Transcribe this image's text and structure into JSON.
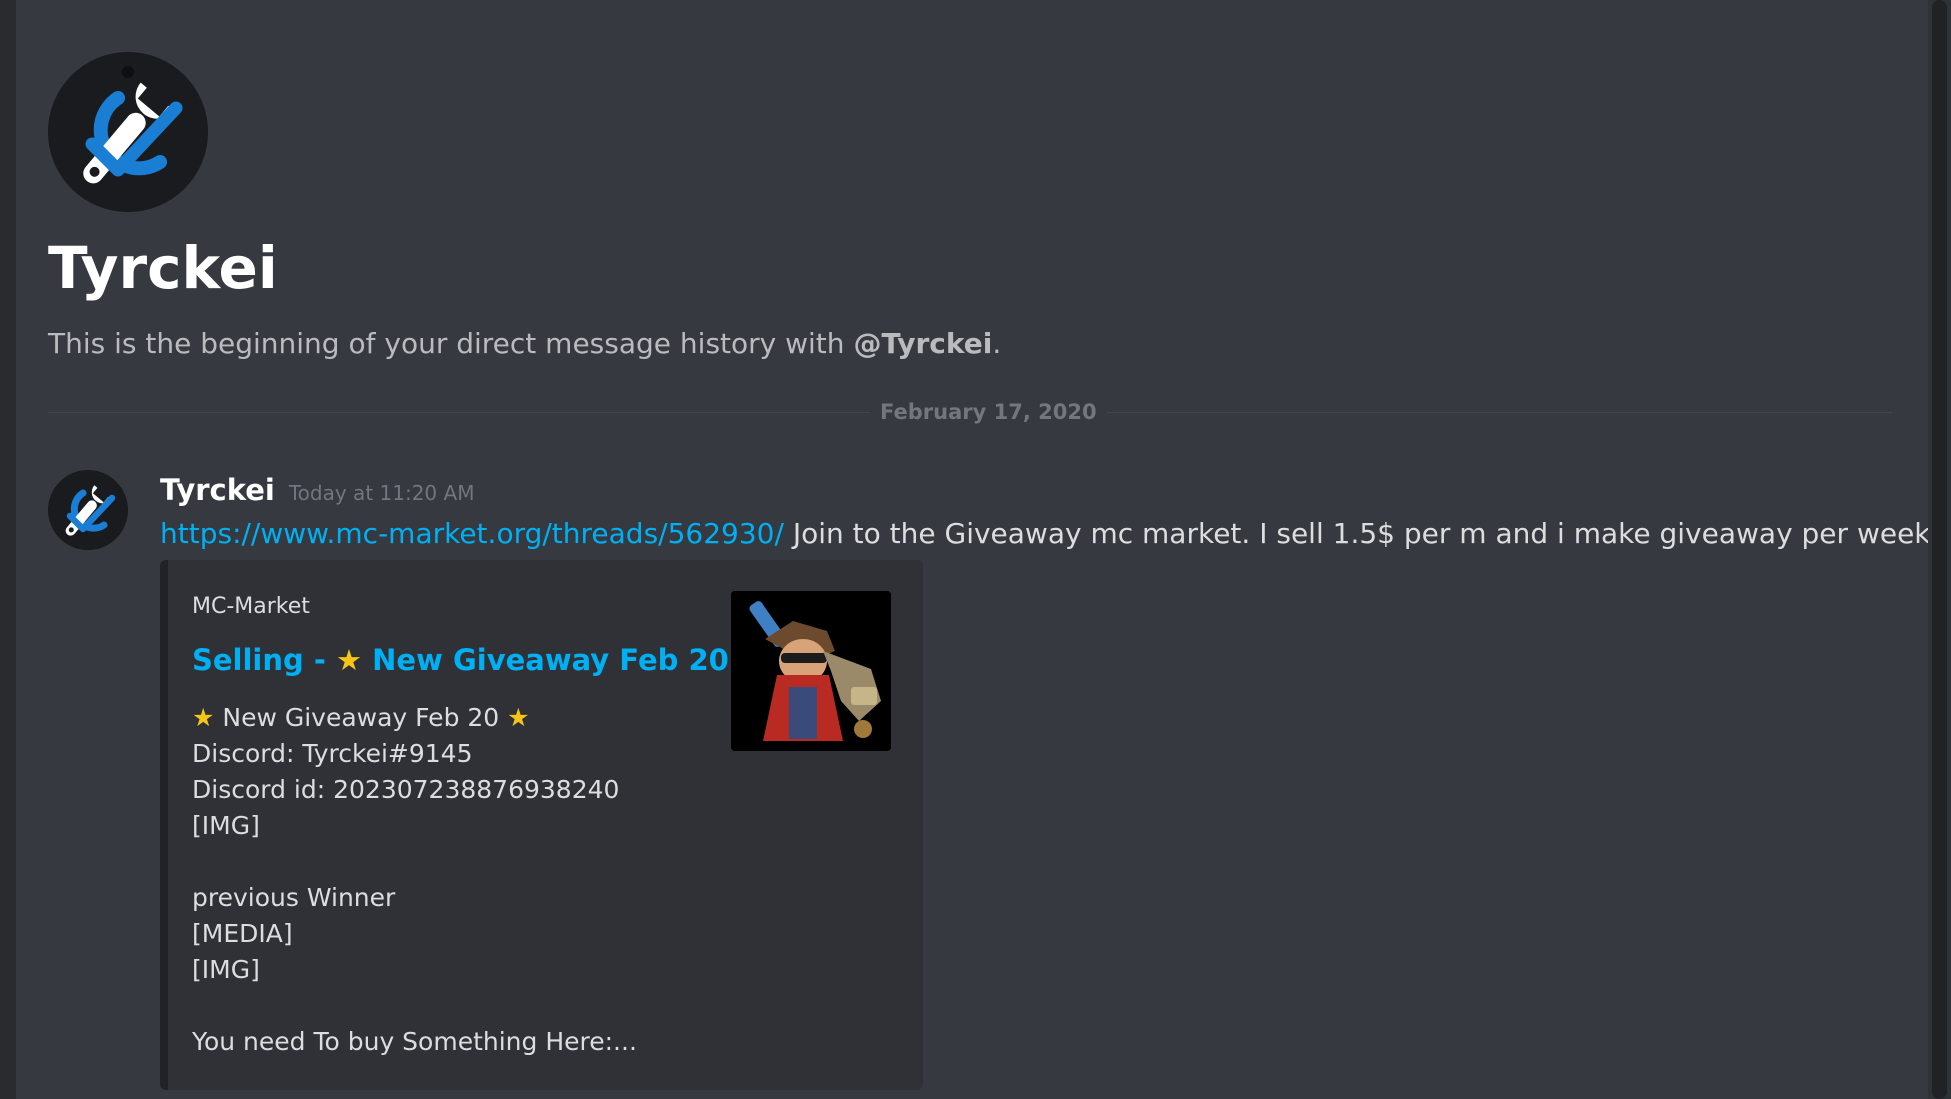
{
  "channel": {
    "title": "Tyrckei",
    "intro_prefix": "This is the beginning of your direct message history with ",
    "intro_mention": "@Tyrckei",
    "intro_suffix": "."
  },
  "divider": {
    "date": "February 17, 2020"
  },
  "message": {
    "author": "Tyrckei",
    "timestamp": "Today at 11:20 AM",
    "link": "https://www.mc-market.org/threads/562930/",
    "text": " Join to the Giveaway  mc market. I sell 1.5$ per m and i make giveaway per week"
  },
  "embed": {
    "provider": "MC-Market",
    "title_prefix": "Selling - ",
    "title_main": "New Giveaway Feb 20",
    "lines": {
      "l1": "New Giveaway Feb 20",
      "l2": "Discord: Tyrckei#9145",
      "l3": "Discord id: 202307238876938240",
      "l4": "[IMG]",
      "l5": "",
      "l6": "previous Winner",
      "l7": "[MEDIA]",
      "l8": "[IMG]",
      "l9": "",
      "l10": "You need To buy Something Here:..."
    },
    "star_glyph": "★"
  },
  "colors": {
    "background": "#36393f",
    "link": "#00b0f4",
    "star": "#f5c518",
    "avatar_blue": "#1a7fd4"
  },
  "icons": {
    "avatar": "wrench-check-icon",
    "thumbnail": "character-thumbnail"
  }
}
